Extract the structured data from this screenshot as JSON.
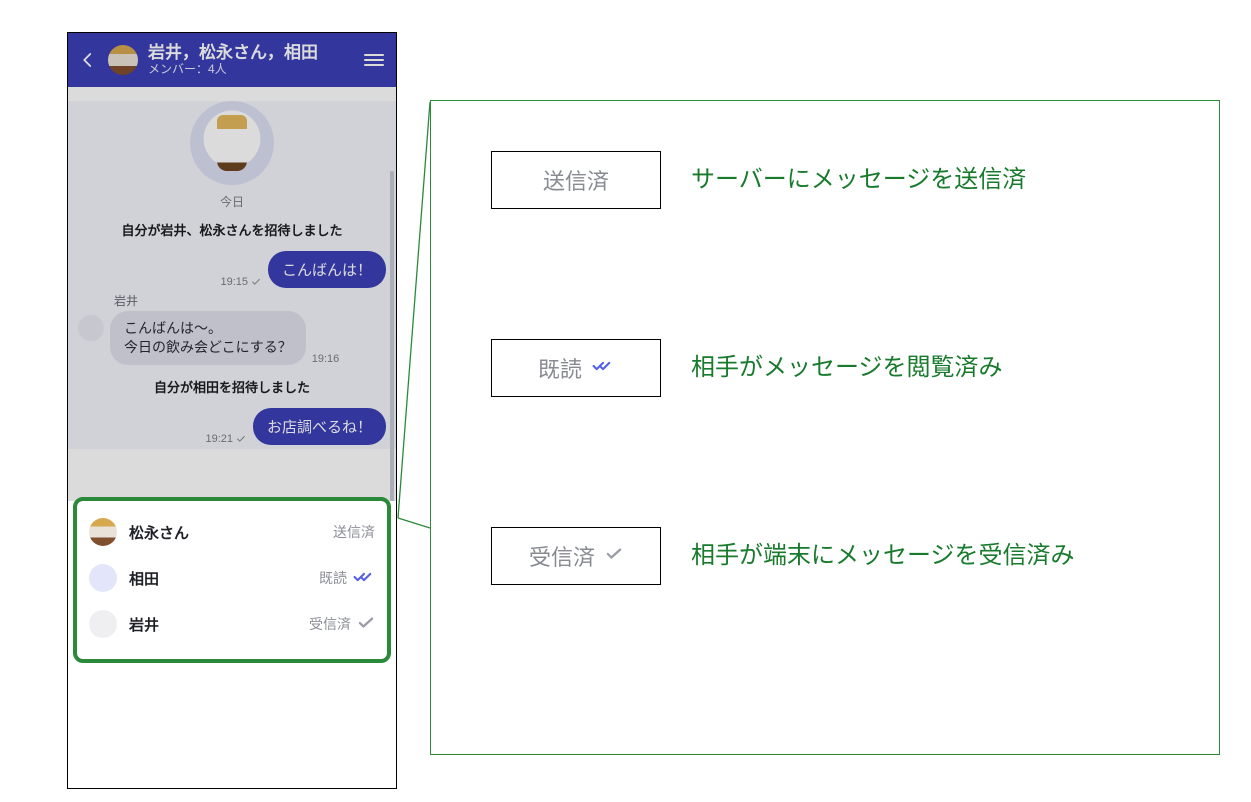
{
  "chat": {
    "title": "岩井，松永さん，相田",
    "subtitle": "メンバー：4人",
    "date_separator": "今日",
    "system1": "自分が岩井、松永さんを招待しました",
    "system2": "自分が相田を招待しました",
    "msg1": {
      "text": "こんばんは！",
      "time": "19:15"
    },
    "msg2": {
      "sender": "岩井",
      "text": "こんばんは〜。\n今日の飲み会どこにする？",
      "time": "19:16"
    },
    "msg3": {
      "text": "お店調べるね！",
      "time": "19:21"
    }
  },
  "status_list": [
    {
      "name": "松永さん",
      "state": "送信済",
      "icon": "none",
      "avatar": "gold"
    },
    {
      "name": "相田",
      "state": "既読",
      "icon": "double",
      "avatar": "blue"
    },
    {
      "name": "岩井",
      "state": "受信済",
      "icon": "single",
      "avatar": "grey"
    }
  ],
  "legend": [
    {
      "badge": "送信済",
      "icon": "none",
      "desc": "サーバーにメッセージを送信済"
    },
    {
      "badge": "既読",
      "icon": "double",
      "desc": "相手がメッセージを閲覧済み"
    },
    {
      "badge": "受信済",
      "icon": "single",
      "desc": "相手が端末にメッセージを受信済み"
    }
  ],
  "colors": {
    "brand": "#3b3fb7",
    "accent_green": "#2a8a3a",
    "text_green": "#187a2c"
  }
}
